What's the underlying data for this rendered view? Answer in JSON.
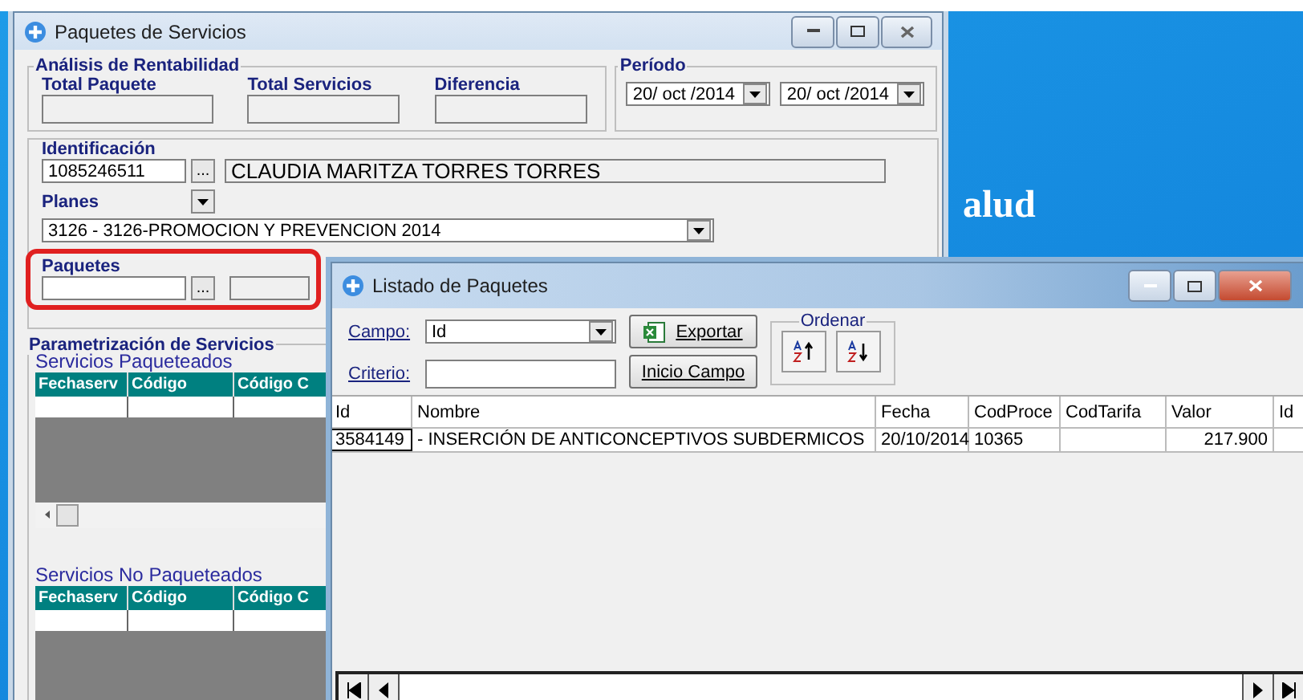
{
  "desktop": {
    "text": "alud"
  },
  "main_window": {
    "title": "Paquetes de Servicios",
    "rentabilidad": {
      "title": "Análisis de Rentabilidad",
      "fields": [
        "Total Paquete",
        "Total Servicios",
        "Diferencia"
      ]
    },
    "periodo": {
      "title": "Período",
      "dates": [
        "20/ oct /2014",
        "20/ oct /2014"
      ]
    },
    "identificacion": {
      "label": "Identificación",
      "value": "1085246511",
      "browse": "...",
      "name": "CLAUDIA MARITZA TORRES TORRES"
    },
    "planes": {
      "label": "Planes",
      "value": "3126 - 3126-PROMOCION Y PREVENCION 2014"
    },
    "paquetes": {
      "label": "Paquetes",
      "browse": "...",
      "highlighted": true
    },
    "parametrizacion": {
      "title": "Parametrización de Servicios",
      "grids": [
        {
          "title": "Servicios Paqueteados",
          "columns": [
            "Fechaserv",
            "Código",
            "Código C"
          ]
        },
        {
          "title": "Servicios No Paqueteados",
          "columns": [
            "Fechaserv",
            "Código",
            "Código C"
          ]
        }
      ]
    }
  },
  "dialog": {
    "title": "Listado de Paquetes",
    "campo": {
      "label": "Campo:",
      "value": "Id"
    },
    "criterio": {
      "label": "Criterio:"
    },
    "buttons": [
      "Exportar",
      "Inicio Campo"
    ],
    "ordenar": {
      "title": "Ordenar"
    },
    "table": {
      "columns": [
        "Id",
        "Nombre",
        "Fecha",
        "CodProce",
        "CodTarifa",
        "Valor",
        "Id"
      ],
      "rows": [
        [
          "3584149",
          "- INSERCIÓN DE ANTICONCEPTIVOS SUBDERMICOS",
          "20/10/2014",
          "10365",
          "",
          "217.900",
          ""
        ]
      ]
    }
  }
}
